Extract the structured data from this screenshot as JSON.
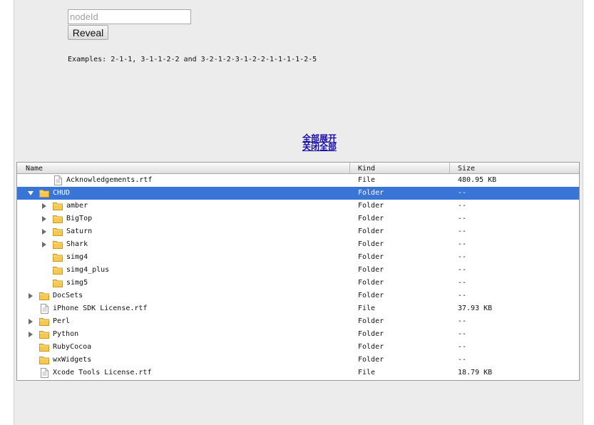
{
  "reveal_form": {
    "nodeid_placeholder": "nodeId",
    "reveal_label": "Reveal",
    "examples_text": "Examples: 2-1-1, 3-1-1-2-2 and 3-2-1-2-3-1-2-2-1-1-1-1-2-5"
  },
  "links": {
    "expand_all": "全部展开",
    "collapse_all": "关闭全部"
  },
  "tree": {
    "columns": {
      "name": "Name",
      "kind": "Kind",
      "size": "Size"
    },
    "rows": [
      {
        "name": "Acknowledgements.rtf",
        "kind": "File",
        "size": "480.95 KB",
        "type": "file",
        "depth": 1,
        "expander": "none",
        "selected": false
      },
      {
        "name": "CHUD",
        "kind": "Folder",
        "size": "--",
        "type": "folder",
        "depth": 0,
        "expander": "expanded",
        "selected": true
      },
      {
        "name": "amber",
        "kind": "Folder",
        "size": "--",
        "type": "folder",
        "depth": 1,
        "expander": "collapsed",
        "selected": false
      },
      {
        "name": "BigTop",
        "kind": "Folder",
        "size": "--",
        "type": "folder",
        "depth": 1,
        "expander": "collapsed",
        "selected": false
      },
      {
        "name": "Saturn",
        "kind": "Folder",
        "size": "--",
        "type": "folder",
        "depth": 1,
        "expander": "collapsed",
        "selected": false
      },
      {
        "name": "Shark",
        "kind": "Folder",
        "size": "--",
        "type": "folder",
        "depth": 1,
        "expander": "collapsed",
        "selected": false
      },
      {
        "name": "simg4",
        "kind": "Folder",
        "size": "--",
        "type": "folder",
        "depth": 1,
        "expander": "none",
        "selected": false
      },
      {
        "name": "simg4_plus",
        "kind": "Folder",
        "size": "--",
        "type": "folder",
        "depth": 1,
        "expander": "none",
        "selected": false
      },
      {
        "name": "simg5",
        "kind": "Folder",
        "size": "--",
        "type": "folder",
        "depth": 1,
        "expander": "none",
        "selected": false
      },
      {
        "name": "DocSets",
        "kind": "Folder",
        "size": "--",
        "type": "folder",
        "depth": 0,
        "expander": "collapsed",
        "selected": false
      },
      {
        "name": "iPhone SDK License.rtf",
        "kind": "File",
        "size": "37.93 KB",
        "type": "file",
        "depth": 0,
        "expander": "none",
        "selected": false
      },
      {
        "name": "Perl",
        "kind": "Folder",
        "size": "--",
        "type": "folder",
        "depth": 0,
        "expander": "collapsed",
        "selected": false
      },
      {
        "name": "Python",
        "kind": "Folder",
        "size": "--",
        "type": "folder",
        "depth": 0,
        "expander": "collapsed",
        "selected": false
      },
      {
        "name": "RubyCocoa",
        "kind": "Folder",
        "size": "--",
        "type": "folder",
        "depth": 0,
        "expander": "none",
        "selected": false
      },
      {
        "name": "wxWidgets",
        "kind": "Folder",
        "size": "--",
        "type": "folder",
        "depth": 0,
        "expander": "none",
        "selected": false
      },
      {
        "name": "Xcode Tools License.rtf",
        "kind": "File",
        "size": "18.79 KB",
        "type": "file",
        "depth": 0,
        "expander": "none",
        "selected": false
      }
    ]
  },
  "colors": {
    "page_background": "#ececec",
    "selection": "#3875d7",
    "link": "#1a0dab",
    "folder_icon": "#f5c94e"
  },
  "icons": {
    "folder": "folder-icon",
    "file": "file-icon",
    "expanded": "triangle-down-icon",
    "collapsed": "triangle-right-icon"
  }
}
